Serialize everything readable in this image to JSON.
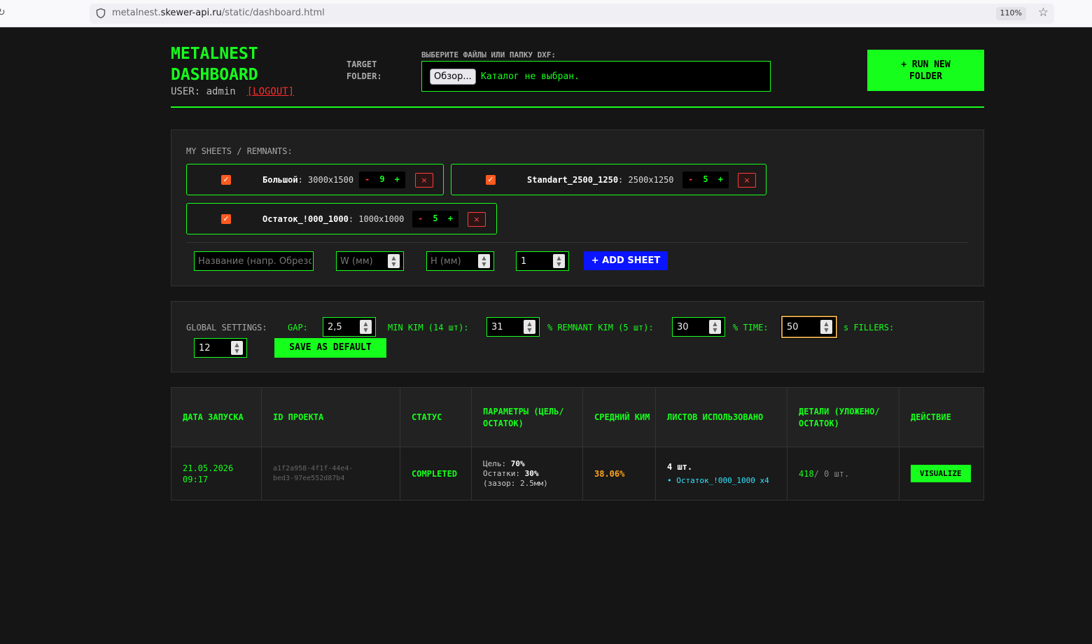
{
  "browser": {
    "url_prefix": "metalnest.",
    "url_host": "skewer-api.ru",
    "url_path": "/static/dashboard.html",
    "zoom": "110%"
  },
  "header": {
    "title_line1": "METALNEST",
    "title_line2": "DASHBOARD",
    "user_label": "USER: admin",
    "logout_label": "[LOGOUT]",
    "target_line1": "TARGET",
    "target_line2": "FOLDER:",
    "dxf_label": "ВЫБЕРИТЕ ФАЙЛЫ ИЛИ ПАПКУ DXF:",
    "browse_label": "Обзор...",
    "no_folder": "Каталог не выбран.",
    "run_line1": "+ RUN NEW",
    "run_line2": "FOLDER"
  },
  "sheets": {
    "title": "MY SHEETS / REMNANTS:",
    "items": [
      {
        "name": "Большой",
        "size": ": 3000x1500",
        "qty": "9",
        "checked": true
      },
      {
        "name": "Standart_2500_1250",
        "size": ": 2500x1250",
        "qty": "5",
        "checked": true
      },
      {
        "name": "Остаток_!000_1000",
        "size": ": 1000x1000",
        "qty": "5",
        "checked": true
      }
    ],
    "minus": "-",
    "plus": "+",
    "delete": "×",
    "new_name_placeholder": "Название (напр. Обрезок)",
    "w_placeholder": "W (мм)",
    "h_placeholder": "H (мм)",
    "count_value": "1",
    "add_label": "+ ADD SHEET"
  },
  "settings": {
    "title": "GLOBAL SETTINGS:",
    "gap_label": "GAP:",
    "gap_value": "2,5",
    "min_kim_label": "MIN KIM (14 шт):",
    "min_kim_value": "31",
    "remnant_label": "% REMNANT KIM (5 шт):",
    "remnant_value": "30",
    "time_label": "% TIME:",
    "time_value": "50",
    "fillers_label": "s FILLERS:",
    "fillers_value": "12",
    "save_label": "SAVE AS DEFAULT"
  },
  "table": {
    "headers": [
      "ДАТА ЗАПУСКА",
      "ID ПРОЕКТА",
      "СТАТУС",
      "ПАРАМЕТРЫ (ЦЕЛЬ/ОСТАТОК)",
      "СРЕДНИЙ КИМ",
      "ЛИСТОВ ИСПОЛЬЗОВАНО",
      "ДЕТАЛИ (УЛОЖЕНО/ ОСТАТОК)",
      "ДЕЙСТВИЕ"
    ],
    "rows": [
      {
        "date": "21.05.2026",
        "time": "09:17",
        "id_line1": "a1f2a958-4f1f-44e4-",
        "id_line2": "bed3-97ee552d87b4",
        "status": "COMPLETED",
        "target_label": "Цель: ",
        "target_value": "70%",
        "remnant_label": "Остатки: ",
        "remnant_value": "30%",
        "gap_text": "(зазор: 2.5мм)",
        "kim": "38.06%",
        "sheets_count": "4 шт.",
        "sheet_item": "• Остаток_!000_1000 x4",
        "parts_placed": "418",
        "parts_rest": " / 0 шт.",
        "action": "VISUALIZE"
      }
    ]
  },
  "colors": {
    "accent": "#16ff1c",
    "danger": "#ff3b3b",
    "add_button": "#0a14ff",
    "kim": "#ffa41b",
    "sheet_item": "#2ee6ff"
  }
}
